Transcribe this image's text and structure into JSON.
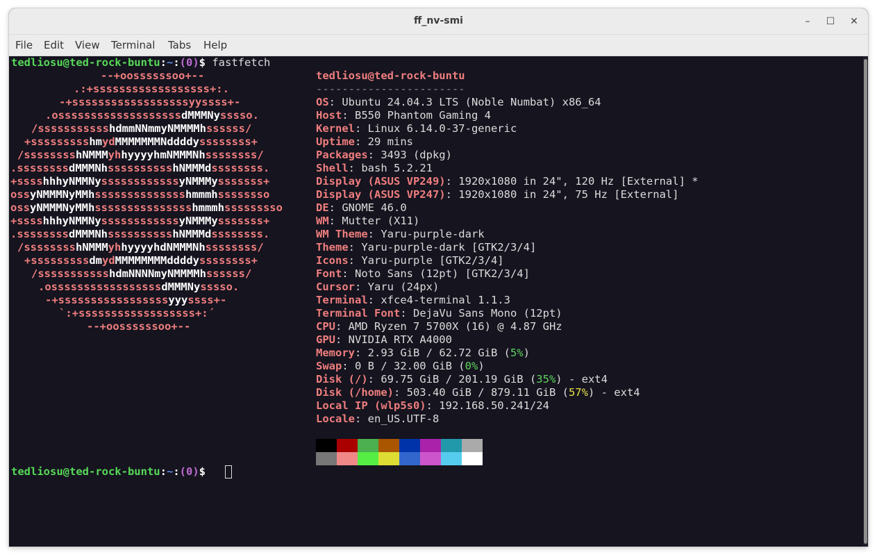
{
  "window": {
    "title": "ff_nv-smi",
    "controls": {
      "minimize": "–",
      "maximize": "☐",
      "close": "✕"
    }
  },
  "menu": [
    "File",
    "Edit",
    "View",
    "Terminal",
    "Tabs",
    "Help"
  ],
  "prompt": {
    "user_host": "tedliosu@ted-rock-buntu",
    "colon": ":",
    "path": "~",
    "status_colon": ":",
    "status": "(0)",
    "dollar": "$",
    "command": " fastfetch"
  },
  "logo": [
    [
      [
        "r",
        "--+oossssssoo+--"
      ]
    ],
    [
      [
        "r",
        ".:+ssssssssssssssssss+:."
      ]
    ],
    [
      [
        "r",
        "-+ssssssssssssssssssyyssss+-"
      ]
    ],
    [
      [
        "r",
        ".osssssssssssssssssss"
      ],
      [
        "w",
        "dMMMNy"
      ],
      [
        "r",
        "sssso."
      ]
    ],
    [
      [
        "r",
        "/sssssssssss"
      ],
      [
        "w",
        "hdmmNNmmyNMMMMh"
      ],
      [
        "r",
        "ssssss/"
      ]
    ],
    [
      [
        "r",
        "+sssssssss"
      ],
      [
        "w",
        "hm"
      ],
      [
        "r",
        "yd"
      ],
      [
        "w",
        "MMMMMMMNddddy"
      ],
      [
        "r",
        "ssssssss+"
      ]
    ],
    [
      [
        "r",
        "/ssssssss"
      ],
      [
        "w",
        "hNMMM"
      ],
      [
        "r",
        "yh"
      ],
      [
        "w",
        "hyyyyhmNMMMNh"
      ],
      [
        "r",
        "ssssssss/"
      ]
    ],
    [
      [
        "r",
        ".ssssssss"
      ],
      [
        "w",
        "dMMMNh"
      ],
      [
        "r",
        "ssssssssss"
      ],
      [
        "w",
        "hNMMMd"
      ],
      [
        "r",
        "ssssssss."
      ]
    ],
    [
      [
        "r",
        "+ssss"
      ],
      [
        "w",
        "hhhyNMMNy"
      ],
      [
        "r",
        "ssssssssssss"
      ],
      [
        "w",
        "yNMMMy"
      ],
      [
        "r",
        "sssssss+"
      ]
    ],
    [
      [
        "r",
        "oss"
      ],
      [
        "w",
        "yNMMMNyMMh"
      ],
      [
        "r",
        "ssssssssssssss"
      ],
      [
        "w",
        "hmmmh"
      ],
      [
        "r",
        "ssssssso"
      ]
    ],
    [
      [
        "r",
        "oss"
      ],
      [
        "w",
        "yNMMMNyMMh"
      ],
      [
        "r",
        "sssssssssssssss"
      ],
      [
        "w",
        "hmmmh"
      ],
      [
        "r",
        "sssssssso"
      ]
    ],
    [
      [
        "r",
        "+ssss"
      ],
      [
        "w",
        "hhhyNMMNy"
      ],
      [
        "r",
        "ssssssssssss"
      ],
      [
        "w",
        "yNMMMy"
      ],
      [
        "r",
        "sssssss+"
      ]
    ],
    [
      [
        "r",
        ".ssssssss"
      ],
      [
        "w",
        "dMMMNh"
      ],
      [
        "r",
        "ssssssssss"
      ],
      [
        "w",
        "hNMMMd"
      ],
      [
        "r",
        "ssssssss."
      ]
    ],
    [
      [
        "r",
        "/ssssssss"
      ],
      [
        "w",
        "hNMMM"
      ],
      [
        "r",
        "yh"
      ],
      [
        "w",
        "hyyyyhdNMMMNh"
      ],
      [
        "r",
        "ssssssss/"
      ]
    ],
    [
      [
        "r",
        "+sssssssss"
      ],
      [
        "w",
        "dm"
      ],
      [
        "r",
        "yd"
      ],
      [
        "w",
        "MMMMMMMMddddy"
      ],
      [
        "r",
        "ssssssss+"
      ]
    ],
    [
      [
        "r",
        "/sssssssssss"
      ],
      [
        "w",
        "hdmNNNNmyNMMMMh"
      ],
      [
        "r",
        "ssssss/"
      ]
    ],
    [
      [
        "r",
        ".osssssssssssssssss"
      ],
      [
        "w",
        "dMMMNy"
      ],
      [
        "r",
        "sssso."
      ]
    ],
    [
      [
        "r",
        "-+sssssssssssssssss"
      ],
      [
        "w",
        "yyy"
      ],
      [
        "r",
        "ssss+-"
      ]
    ],
    [
      [
        "r",
        "`:+ssssssssssssssssss+:´"
      ]
    ],
    [
      [
        "r",
        "--+oossssssoo+--"
      ]
    ]
  ],
  "info": {
    "header": "tedliosu@ted-rock-buntu",
    "separator": "-----------------------",
    "rows": [
      [
        [
          "k",
          "OS"
        ],
        [
          "v",
          ": Ubuntu 24.04.3 LTS (Noble Numbat) x86_64"
        ]
      ],
      [
        [
          "k",
          "Host"
        ],
        [
          "v",
          ": B550 Phantom Gaming 4"
        ]
      ],
      [
        [
          "k",
          "Kernel"
        ],
        [
          "v",
          ": Linux 6.14.0-37-generic"
        ]
      ],
      [
        [
          "k",
          "Uptime"
        ],
        [
          "v",
          ": 29 mins"
        ]
      ],
      [
        [
          "k",
          "Packages"
        ],
        [
          "v",
          ": 3493 (dpkg)"
        ]
      ],
      [
        [
          "k",
          "Shell"
        ],
        [
          "v",
          ": bash 5.2.21"
        ]
      ],
      [
        [
          "k",
          "Display (ASUS VP249)"
        ],
        [
          "v",
          ": 1920x1080 in 24\", 120 Hz [External] *"
        ]
      ],
      [
        [
          "k",
          "Display (ASUS VP247)"
        ],
        [
          "v",
          ": 1920x1080 in 24\", 75 Hz [External]"
        ]
      ],
      [
        [
          "k",
          "DE"
        ],
        [
          "v",
          ": GNOME 46.0"
        ]
      ],
      [
        [
          "k",
          "WM"
        ],
        [
          "v",
          ": Mutter (X11)"
        ]
      ],
      [
        [
          "k",
          "WM Theme"
        ],
        [
          "v",
          ": Yaru-purple-dark"
        ]
      ],
      [
        [
          "k",
          "Theme"
        ],
        [
          "v",
          ": Yaru-purple-dark [GTK2/3/4]"
        ]
      ],
      [
        [
          "k",
          "Icons"
        ],
        [
          "v",
          ": Yaru-purple [GTK2/3/4]"
        ]
      ],
      [
        [
          "k",
          "Font"
        ],
        [
          "v",
          ": Noto Sans (12pt) [GTK2/3/4]"
        ]
      ],
      [
        [
          "k",
          "Cursor"
        ],
        [
          "v",
          ": Yaru (24px)"
        ]
      ],
      [
        [
          "k",
          "Terminal"
        ],
        [
          "v",
          ": xfce4-terminal 1.1.3"
        ]
      ],
      [
        [
          "k",
          "Terminal Font"
        ],
        [
          "v",
          ": DejaVu Sans Mono (12pt)"
        ]
      ],
      [
        [
          "k",
          "CPU"
        ],
        [
          "v",
          ": AMD Ryzen 7 5700X (16) @ 4.87 GHz"
        ]
      ],
      [
        [
          "k",
          "GPU"
        ],
        [
          "v",
          ": NVIDIA RTX A4000"
        ]
      ],
      [
        [
          "k",
          "Memory"
        ],
        [
          "v",
          ": 2.93 GiB / 62.72 GiB ("
        ],
        [
          "gr",
          "5%"
        ],
        [
          "v",
          ")"
        ]
      ],
      [
        [
          "k",
          "Swap"
        ],
        [
          "v",
          ": 0 B / 32.00 GiB ("
        ],
        [
          "gr",
          "0%"
        ],
        [
          "v",
          ")"
        ]
      ],
      [
        [
          "k",
          "Disk (/)"
        ],
        [
          "v",
          ": 69.75 GiB / 201.19 GiB ("
        ],
        [
          "gr",
          "35%"
        ],
        [
          "v",
          ") - ext4"
        ]
      ],
      [
        [
          "k",
          "Disk (/home)"
        ],
        [
          "v",
          ": 503.40 GiB / 879.11 GiB ("
        ],
        [
          "yl",
          "57%"
        ],
        [
          "v",
          ") - ext4"
        ]
      ],
      [
        [
          "k",
          "Local IP (wlp5s0)"
        ],
        [
          "v",
          ": 192.168.50.241/24"
        ]
      ],
      [
        [
          "k",
          "Locale"
        ],
        [
          "v",
          ": en_US.UTF-8"
        ]
      ]
    ]
  },
  "palette": {
    "normal": [
      "#000000",
      "#aa0000",
      "#4caf50",
      "#aa5500",
      "#0033aa",
      "#aa22aa",
      "#2299aa",
      "#aaaaaa"
    ],
    "bright": [
      "#777777",
      "#f08888",
      "#55ee44",
      "#dddd33",
      "#3366cc",
      "#cc55cc",
      "#55ccee",
      "#ffffff"
    ]
  }
}
